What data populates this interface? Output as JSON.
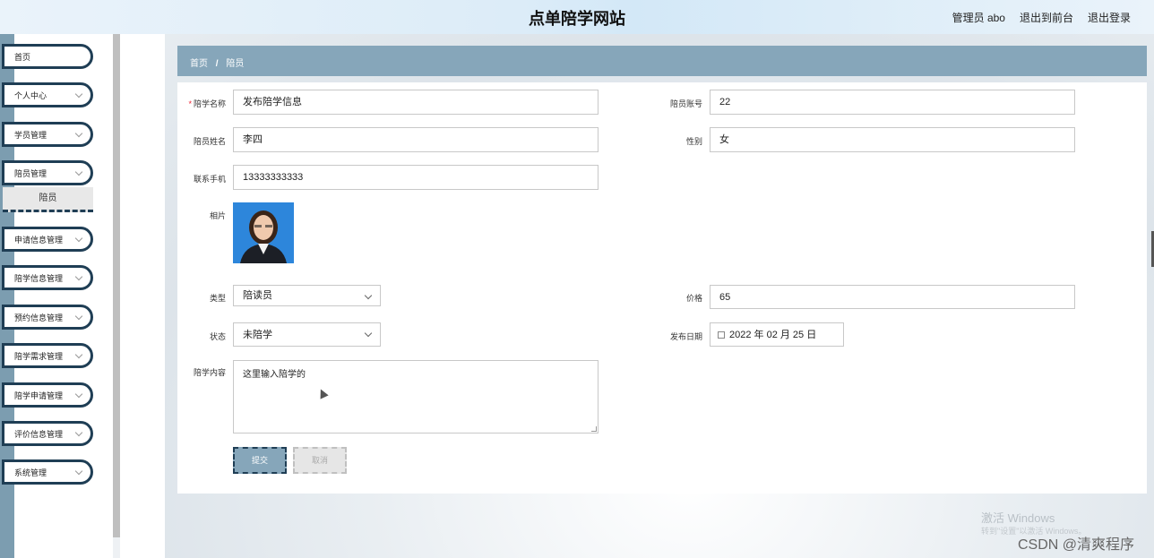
{
  "header": {
    "title": "点单陪学网站",
    "user_label": "管理员 abo",
    "to_front_label": "退出到前台",
    "logout_label": "退出登录"
  },
  "sidebar": {
    "items": [
      {
        "label": "首页"
      },
      {
        "label": "个人中心"
      },
      {
        "label": "学员管理"
      },
      {
        "label": "陪员管理"
      },
      {
        "label": "申请信息管理"
      },
      {
        "label": "陪学信息管理"
      },
      {
        "label": "预约信息管理"
      },
      {
        "label": "陪学需求管理"
      },
      {
        "label": "陪学申请管理"
      },
      {
        "label": "评价信息管理"
      },
      {
        "label": "系统管理"
      }
    ],
    "subitem_active": "陪员"
  },
  "breadcrumb": {
    "home": "首页",
    "separator": "/",
    "current": "陪员"
  },
  "form": {
    "field_name_label": "陪学名称",
    "field_name_value": "发布陪学信息",
    "account_label": "陪员账号",
    "account_value": "22",
    "person_name_label": "陪员姓名",
    "person_name_value": "李四",
    "gender_label": "性别",
    "gender_value": "女",
    "phone_label": "联系手机",
    "phone_value": "13333333333",
    "photo_label": "相片",
    "type_label": "类型",
    "type_value": "陪读员",
    "price_label": "价格",
    "price_value": "65",
    "status_label": "状态",
    "status_value": "未陪学",
    "date_label": "发布日期",
    "date_value": "2022 年 02 月 25 日",
    "content_label": "陪学内容",
    "content_value": "这里输入陪学的",
    "submit_label": "提交",
    "cancel_label": "取消"
  },
  "watermark": {
    "line1": "激活 Windows",
    "line2": "转到\"设置\"以激活 Windows。",
    "csdn": "CSDN @清爽程序"
  },
  "colors": {
    "accent": "#86a6ba",
    "dark_border": "#1f3e55",
    "required": "#e22233"
  }
}
